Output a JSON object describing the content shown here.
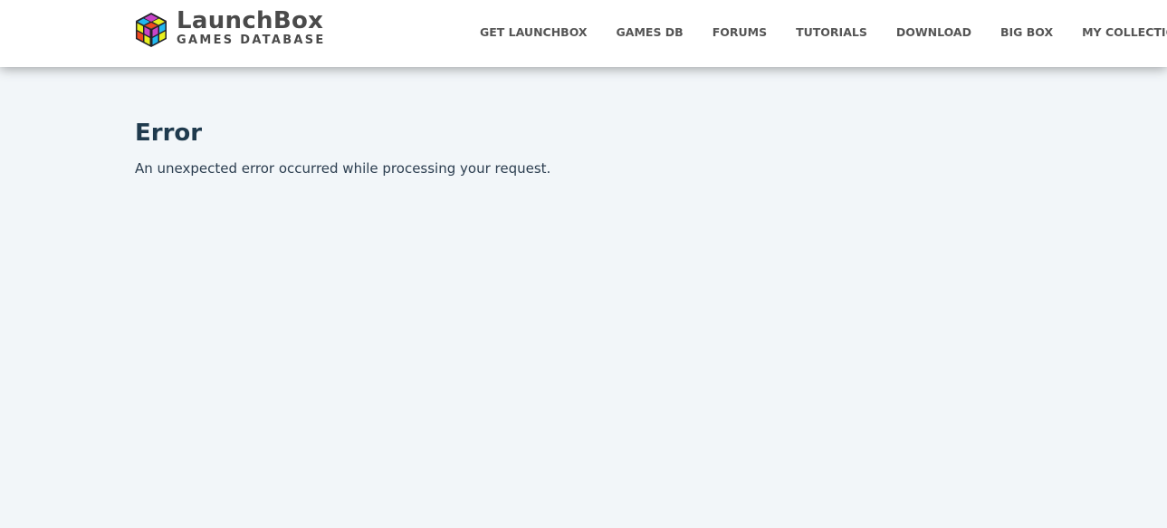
{
  "header": {
    "logo": {
      "icon": "rubiks-cube-icon",
      "title": "LaunchBox",
      "subtitle": "GAMES DATABASE"
    },
    "nav": [
      {
        "label": "GET LAUNCHBOX"
      },
      {
        "label": "GAMES DB"
      },
      {
        "label": "FORUMS"
      },
      {
        "label": "TUTORIALS"
      },
      {
        "label": "DOWNLOAD"
      },
      {
        "label": "BIG BOX"
      },
      {
        "label": "MY COLLECTION"
      }
    ]
  },
  "main": {
    "title": "Error",
    "message": "An unexpected error occurred while processing your request."
  },
  "colors": {
    "page_background": "#f2f6f9",
    "header_background": "#ffffff",
    "heading": "#1f3a4d",
    "nav_text": "#555555"
  }
}
